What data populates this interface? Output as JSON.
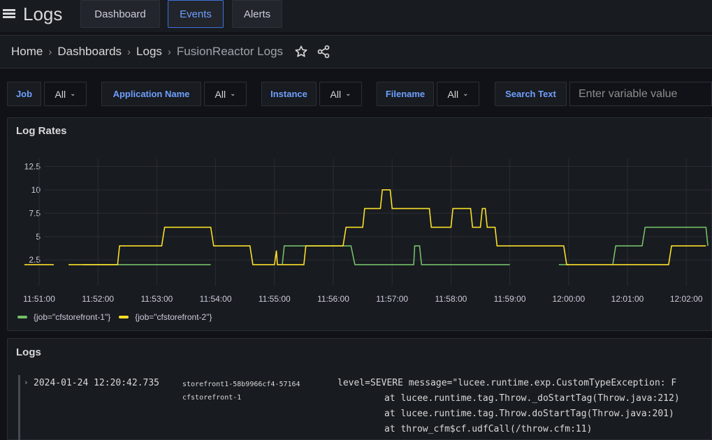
{
  "header": {
    "title": "Logs",
    "tabs": [
      {
        "label": "Dashboard",
        "active": false
      },
      {
        "label": "Events",
        "active": true
      },
      {
        "label": "Alerts",
        "active": false
      }
    ]
  },
  "breadcrumb": {
    "items": [
      "Home",
      "Dashboards",
      "Logs",
      "FusionReactor Logs"
    ],
    "separator": "›"
  },
  "variables": [
    {
      "label": "Job",
      "value": "All"
    },
    {
      "label": "Application Name",
      "value": "All"
    },
    {
      "label": "Instance",
      "value": "All"
    },
    {
      "label": "Filename",
      "value": "All"
    },
    {
      "label": "Search Text",
      "placeholder": "Enter variable value"
    }
  ],
  "log_rates_panel": {
    "title": "Log Rates"
  },
  "chart_data": {
    "type": "line",
    "x": [
      "11:51:00",
      "11:52:00",
      "11:53:00",
      "11:54:00",
      "11:55:00",
      "11:56:00",
      "11:57:00",
      "11:58:00",
      "11:59:00",
      "12:00:00",
      "12:01:00",
      "12:02:00"
    ],
    "y_ticks": [
      "2.5",
      "5",
      "7.5",
      "10",
      "12.5"
    ],
    "ylim": [
      0.5,
      13.2
    ],
    "series": [
      {
        "name": "{job=\"cfstorefront-1\"}",
        "color": "#73bf69",
        "points": [
          [
            "11:55:08",
            2
          ],
          [
            "11:55:10",
            4
          ],
          [
            "11:56:18",
            4
          ],
          [
            "11:56:22",
            2
          ],
          [
            "11:57:22",
            2
          ],
          [
            "11:57:23",
            4
          ],
          [
            "11:57:28",
            4
          ],
          [
            "11:57:30",
            2
          ],
          [
            "11:59:00",
            2
          ]
        ],
        "segments_extra": [
          [
            [
              "11:51:45",
              2
            ],
            [
              "11:53:55",
              2
            ]
          ],
          [
            [
              "11:59:50",
              2
            ],
            [
              "12:00:00",
              2
            ]
          ],
          [
            [
              "12:00:45",
              2
            ],
            [
              "12:00:48",
              4
            ],
            [
              "12:01:15",
              4
            ],
            [
              "12:01:18",
              6
            ],
            [
              "12:02:20",
              6
            ],
            [
              "12:02:22",
              4
            ]
          ]
        ]
      },
      {
        "name": "{job=\"cfstorefront-2\"}",
        "color": "#fade2a",
        "points": [
          [
            "11:50:45",
            2
          ],
          [
            "11:51:15",
            2
          ]
        ],
        "segments_extra": [
          [
            [
              "11:51:30",
              2
            ],
            [
              "11:52:20",
              2
            ],
            [
              "11:52:22",
              4
            ],
            [
              "11:53:05",
              4
            ],
            [
              "11:53:08",
              6
            ],
            [
              "11:53:55",
              6
            ],
            [
              "11:53:58",
              4
            ],
            [
              "11:54:35",
              4
            ],
            [
              "11:54:38",
              2
            ],
            [
              "11:55:00",
              2
            ],
            [
              "11:55:02",
              3.5
            ],
            [
              "11:55:03",
              2
            ],
            [
              "11:55:08",
              2
            ],
            [
              "11:55:30",
              2
            ],
            [
              "11:55:32",
              4
            ],
            [
              "11:56:10",
              4
            ],
            [
              "11:56:13",
              6
            ],
            [
              "11:56:30",
              6
            ],
            [
              "11:56:32",
              8
            ],
            [
              "11:56:48",
              8
            ],
            [
              "11:56:50",
              10
            ],
            [
              "11:56:58",
              10
            ],
            [
              "11:57:00",
              8
            ],
            [
              "11:57:38",
              8
            ],
            [
              "11:57:40",
              6
            ],
            [
              "11:58:00",
              6
            ],
            [
              "11:58:02",
              8
            ],
            [
              "11:58:20",
              8
            ],
            [
              "11:58:22",
              6
            ],
            [
              "11:58:30",
              6
            ],
            [
              "11:58:32",
              8
            ],
            [
              "11:58:35",
              8
            ],
            [
              "11:58:37",
              6
            ],
            [
              "11:58:45",
              6
            ],
            [
              "11:58:47",
              4
            ],
            [
              "11:59:55",
              4
            ],
            [
              "11:59:58",
              2
            ],
            [
              "12:00:30",
              2
            ],
            [
              "12:00:33",
              2
            ],
            [
              "12:01:42",
              2
            ],
            [
              "12:01:45",
              4
            ],
            [
              "12:02:20",
              4
            ]
          ]
        ]
      }
    ]
  },
  "logs_panel": {
    "title": "Logs",
    "entry": {
      "timestamp": "2024-01-24 12:20:42.735",
      "instance": "storefront1-58b9966cf4-57164",
      "job": "cfstorefront-1",
      "line1": "level=SEVERE message=\"lucee.runtime.exp.CustomTypeException: F",
      "line2": "at lucee.runtime.tag.Throw._doStartTag(Throw.java:212)",
      "line3": "at lucee.runtime.tag.Throw.doStartTag(Throw.java:201)",
      "line4": "at throw_cfm$cf.udfCall(/throw.cfm:11)"
    }
  },
  "colors": {
    "accent": "#6e9fff",
    "series1": "#73bf69",
    "series2": "#fade2a"
  }
}
